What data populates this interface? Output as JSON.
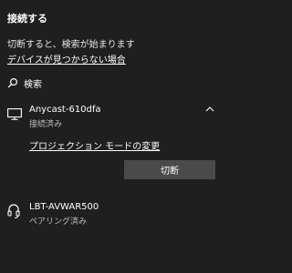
{
  "panel": {
    "title": "接続する",
    "description": "切断すると、検索が始まります",
    "help_link": "デバイスが見つからない場合",
    "search_label": "検索"
  },
  "devices": [
    {
      "name": "Anycast-610dfa",
      "status": "接続済み",
      "icon": "monitor-icon",
      "expanded": true,
      "projection_link": "プロジェクション モードの変更",
      "disconnect_label": "切断"
    },
    {
      "name": "LBT-AVWAR500",
      "status": "ペアリング済み",
      "icon": "headset-icon",
      "expanded": false
    }
  ],
  "colors": {
    "background": "#1f1f1f",
    "button": "#4a4a4a",
    "secondary_text": "#bdbdbd"
  }
}
